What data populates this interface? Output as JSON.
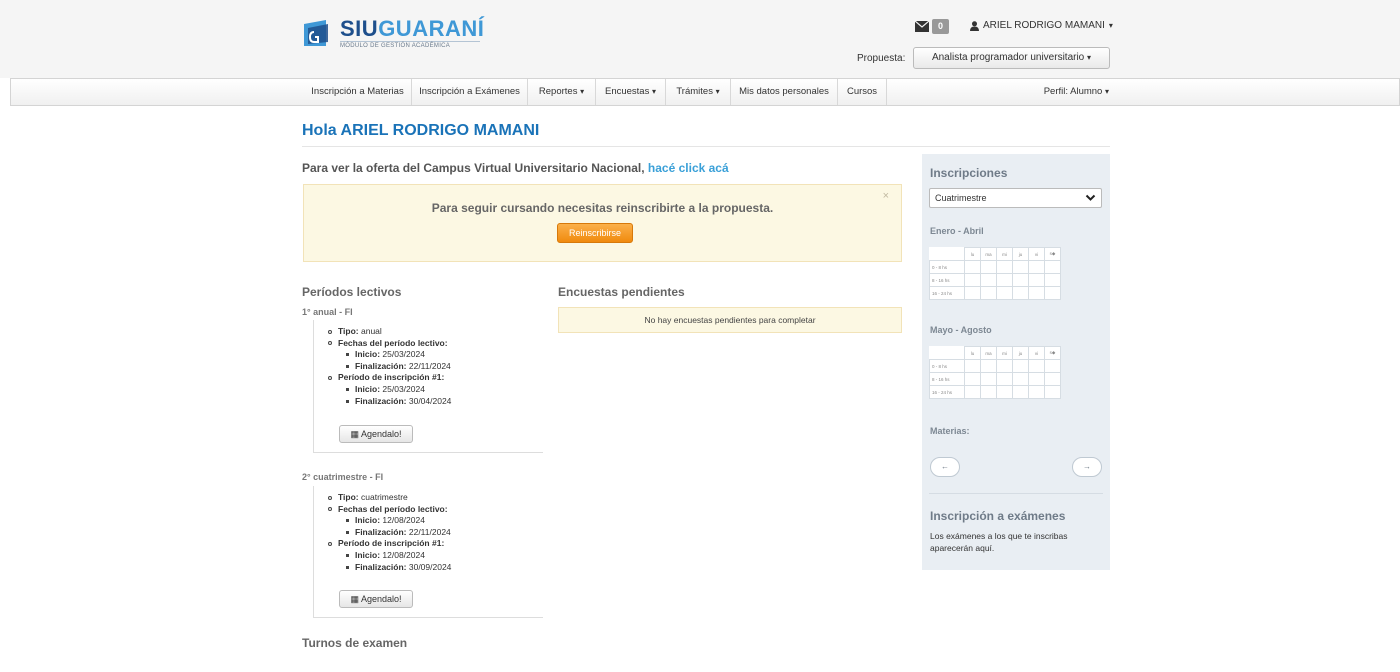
{
  "header": {
    "logo_siu": "SIU",
    "logo_guarani": "GUARANÍ",
    "logo_subtitle": "MÓDULO DE GESTIÓN ACADÉMICA",
    "messages_count": "0",
    "user_name": "ARIEL RODRIGO MAMANI",
    "propuesta_label": "Propuesta:",
    "propuesta_value": "Analista programador universitario"
  },
  "nav": {
    "items": [
      {
        "label": "Inscripción a Materias"
      },
      {
        "label": "Inscripción a Exámenes"
      },
      {
        "label": "Reportes"
      },
      {
        "label": "Encuestas"
      },
      {
        "label": "Trámites"
      },
      {
        "label": "Mis datos personales"
      },
      {
        "label": "Cursos"
      }
    ],
    "perfil": "Perfil: Alumno"
  },
  "main": {
    "greeting": "Hola ARIEL RODRIGO MAMANI",
    "campus_text": "Para ver la oferta del Campus Virtual Universitario Nacional,",
    "campus_link": "hacé click acá",
    "alert_text": "Para seguir cursando necesitas reinscribirte a la propuesta.",
    "alert_close": "×",
    "reinscribirse_label": "Reinscribirse",
    "periodos_title": "Períodos lectivos",
    "periodos": [
      {
        "name": "1° anual - FI",
        "tipo_label": "Tipo:",
        "tipo": "anual",
        "fechas_label": "Fechas del período lectivo:",
        "inicio_label": "Inicio:",
        "inicio": "25/03/2024",
        "fin_label": "Finalización:",
        "fin": "22/11/2024",
        "insc_label": "Período de inscripción #1:",
        "insc_inicio": "25/03/2024",
        "insc_fin": "30/04/2024",
        "agenda_label": "Agendalo!"
      },
      {
        "name": "2° cuatrimestre - FI",
        "tipo_label": "Tipo:",
        "tipo": "cuatrimestre",
        "fechas_label": "Fechas del período lectivo:",
        "inicio_label": "Inicio:",
        "inicio": "12/08/2024",
        "fin_label": "Finalización:",
        "fin": "22/11/2024",
        "insc_label": "Período de inscripción #1:",
        "insc_inicio": "12/08/2024",
        "insc_fin": "30/09/2024",
        "agenda_label": "Agendalo!"
      }
    ],
    "encuestas_title": "Encuestas pendientes",
    "encuestas_empty": "No hay encuestas pendientes para completar",
    "turnos_title": "Turnos de examen"
  },
  "sidebar": {
    "title": "Inscripciones",
    "select_value": "Cuatrimestre",
    "period1": "Enero - Abril",
    "period2": "Mayo - Agosto",
    "days": [
      "lu",
      "ma",
      "mi",
      "ju",
      "vi",
      "s"
    ],
    "rows": [
      "0 - 8 hs",
      "8 - 16 hs",
      "16 - 24 hs"
    ],
    "materias_label": "Materias:",
    "prev_arrow": "←",
    "next_arrow": "→",
    "exam_title": "Inscripción a exámenes",
    "exam_text": "Los exámenes a los que te inscribas aparecerán aquí."
  }
}
